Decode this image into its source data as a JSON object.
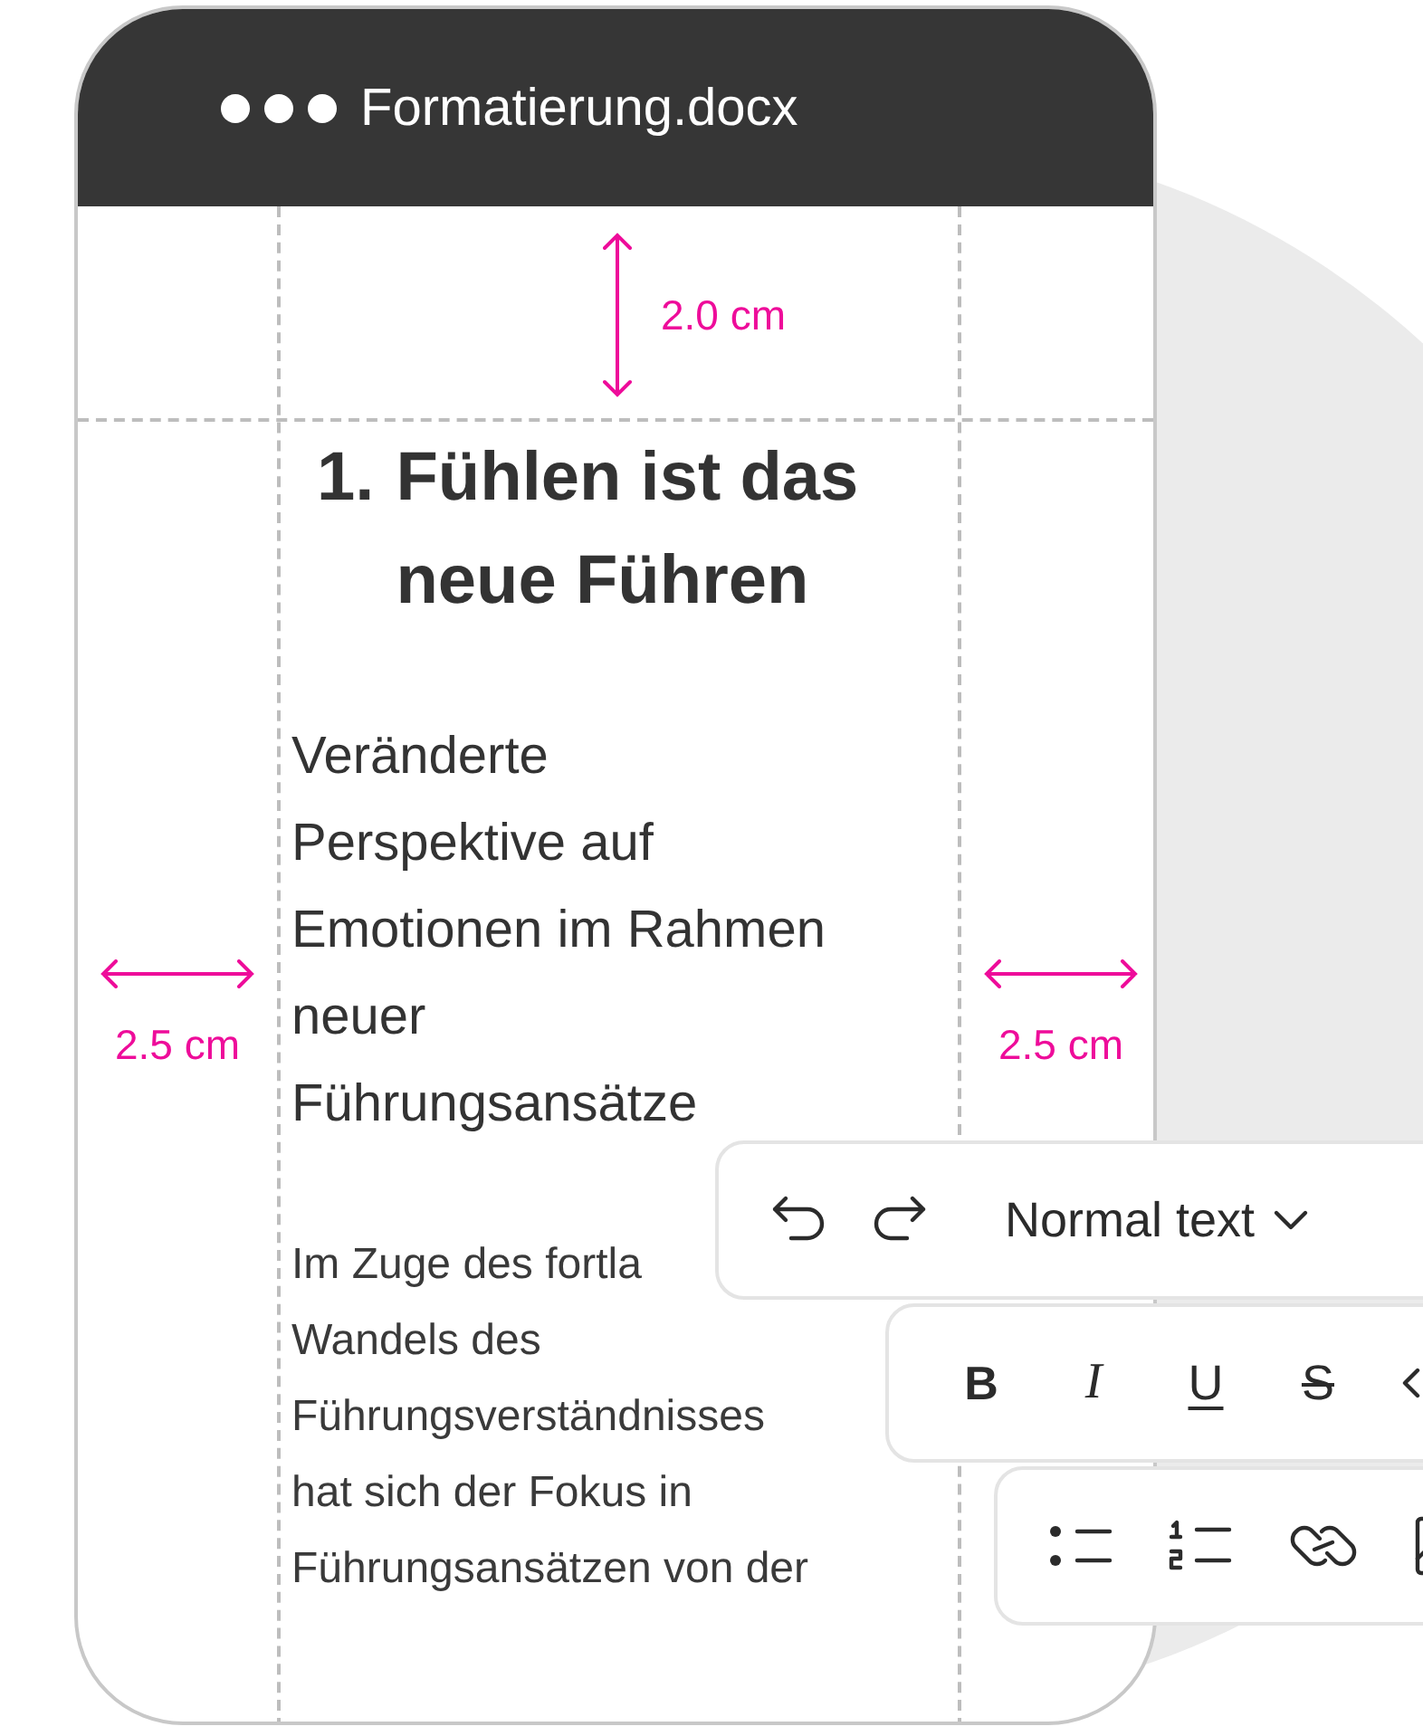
{
  "window": {
    "title": "Formatierung.docx"
  },
  "margins": [
    {
      "kind": "top",
      "label": "2.0 cm"
    },
    {
      "kind": "left",
      "label": "2.5 cm"
    },
    {
      "kind": "right",
      "label": "2.5 cm"
    }
  ],
  "document": {
    "heading_number": "1.",
    "heading_lines": [
      "Fühlen ist das",
      "neue Führen"
    ],
    "subheading_lines": [
      "Veränderte",
      "Perspektive auf",
      "Emotionen im Rahmen",
      "neuer",
      "Führungsansätze"
    ],
    "body_lines": [
      "Im Zuge des fortla",
      "Wandels des",
      "Führungsverständnisses",
      "hat sich der Fokus in",
      "Führungsansätzen von der"
    ]
  },
  "toolbars": [
    {
      "items": [
        {
          "kind": "undo"
        },
        {
          "kind": "redo"
        },
        {
          "kind": "dropdown",
          "label": "Normal text"
        }
      ]
    },
    {
      "items": [
        {
          "kind": "bold",
          "label": "B"
        },
        {
          "kind": "italic",
          "label": "I"
        },
        {
          "kind": "underline",
          "label": "U"
        },
        {
          "kind": "strikethrough",
          "label": "S"
        },
        {
          "kind": "code"
        }
      ]
    },
    {
      "items": [
        {
          "kind": "bullet_list"
        },
        {
          "kind": "numbered_list"
        },
        {
          "kind": "link"
        },
        {
          "kind": "image"
        }
      ]
    }
  ]
}
